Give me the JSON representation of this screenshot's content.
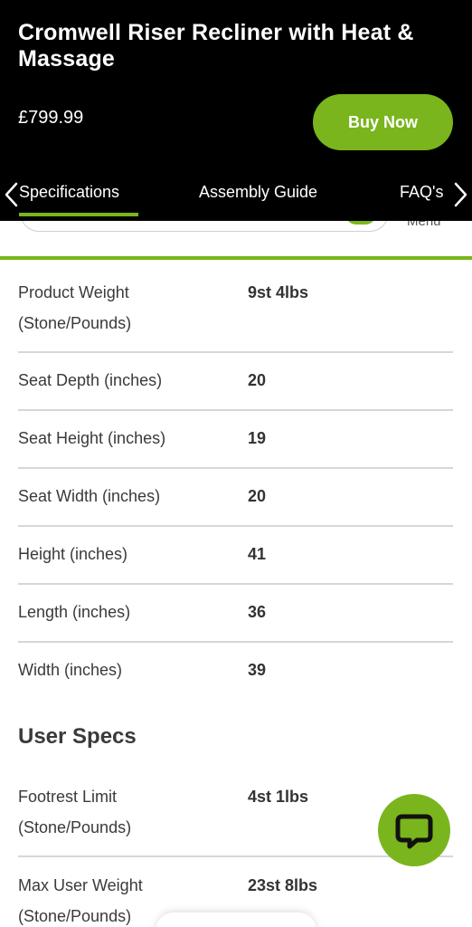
{
  "product": {
    "title": "Cromwell Riser Recliner with Heat & Massage",
    "price": "£799.99",
    "buy_label": "Buy Now"
  },
  "tabs": [
    {
      "label": "Specifications",
      "active": true
    },
    {
      "label": "Assembly Guide",
      "active": false
    },
    {
      "label": "FAQ's",
      "active": false
    }
  ],
  "peek": {
    "menu_text": "Menu"
  },
  "specs": [
    {
      "label": "Product Weight (Stone/Pounds)",
      "value": "9st 4lbs"
    },
    {
      "label": "Seat Depth (inches)",
      "value": "20"
    },
    {
      "label": "Seat Height (inches)",
      "value": "19"
    },
    {
      "label": "Seat Width (inches)",
      "value": "20"
    },
    {
      "label": "Height (inches)",
      "value": "41"
    },
    {
      "label": "Length (inches)",
      "value": "36"
    },
    {
      "label": "Width (inches)",
      "value": "39"
    }
  ],
  "user_specs": {
    "heading": "User Specs",
    "rows": [
      {
        "label": "Footrest Limit (Stone/Pounds)",
        "value": "4st 1lbs"
      },
      {
        "label": "Max User Weight (Stone/Pounds)",
        "value": "23st 8lbs"
      }
    ]
  },
  "colors": {
    "accent": "#7ab51d",
    "header_bg": "#000000",
    "divider": "#d6d6d6"
  },
  "icons": {
    "chat": "chat-bubble-icon",
    "prev": "chevron-left-icon",
    "next": "chevron-right-icon"
  }
}
